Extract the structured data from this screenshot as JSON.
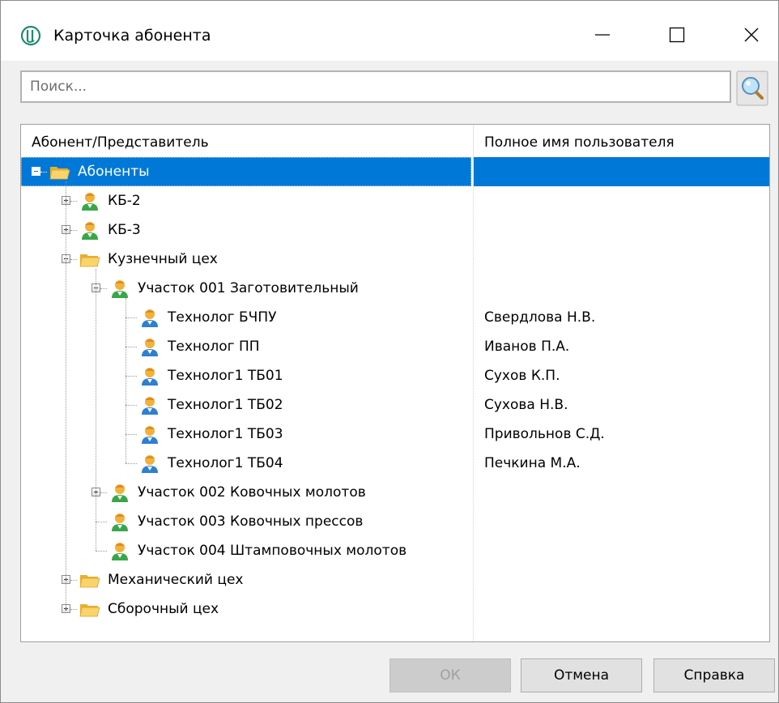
{
  "window": {
    "title": "Карточка абонента",
    "controls": {
      "minimize": "minimize-icon",
      "maximize": "maximize-icon",
      "close": "close-icon"
    }
  },
  "search": {
    "placeholder": "Поиск...",
    "value": "",
    "button_icon": "search-magnifier-icon"
  },
  "tree": {
    "columns": [
      "Абонент/Представитель",
      "Полное имя пользователя"
    ],
    "rows": [
      {
        "label": "Абоненты",
        "fullname": "",
        "level": 0,
        "icon": "folder-open-icon",
        "expander": "minus",
        "selected": true
      },
      {
        "label": "КБ-2",
        "fullname": "",
        "level": 1,
        "icon": "user-green-icon",
        "expander": "plus"
      },
      {
        "label": "КБ-3",
        "fullname": "",
        "level": 1,
        "icon": "user-green-icon",
        "expander": "plus"
      },
      {
        "label": "Кузнечный цех",
        "fullname": "",
        "level": 1,
        "icon": "folder-open-icon",
        "expander": "minus"
      },
      {
        "label": "Участок 001 Заготовительный",
        "fullname": "",
        "level": 2,
        "icon": "user-green-icon",
        "expander": "minus"
      },
      {
        "label": "Технолог БЧПУ",
        "fullname": "Свердлова Н.В.",
        "level": 3,
        "icon": "user-blue-icon"
      },
      {
        "label": "Технолог ПП",
        "fullname": "Иванов П.А.",
        "level": 3,
        "icon": "user-blue-icon"
      },
      {
        "label": "Технолог1 ТБ01",
        "fullname": "Сухов К.П.",
        "level": 3,
        "icon": "user-blue-icon"
      },
      {
        "label": "Технолог1 ТБ02",
        "fullname": "Сухова Н.В.",
        "level": 3,
        "icon": "user-blue-icon"
      },
      {
        "label": "Технолог1 ТБ03",
        "fullname": "Привольнов С.Д.",
        "level": 3,
        "icon": "user-blue-icon"
      },
      {
        "label": "Технолог1 ТБ04",
        "fullname": "Печкина М.А.",
        "level": 3,
        "icon": "user-blue-icon"
      },
      {
        "label": "Участок 002 Ковочных молотов",
        "fullname": "",
        "level": 2,
        "icon": "user-green-icon",
        "expander": "plus"
      },
      {
        "label": "Участок 003 Ковочных прессов",
        "fullname": "",
        "level": 2,
        "icon": "user-green-icon"
      },
      {
        "label": "Участок 004 Штамповочных молотов",
        "fullname": "",
        "level": 2,
        "icon": "user-green-icon"
      },
      {
        "label": "Механический цех",
        "fullname": "",
        "level": 1,
        "icon": "folder-open-icon",
        "expander": "plus"
      },
      {
        "label": "Сборочный цех",
        "fullname": "",
        "level": 1,
        "icon": "folder-open-icon",
        "expander": "plus"
      }
    ]
  },
  "buttons": {
    "ok": "ОК",
    "cancel": "Отмена",
    "help": "Справка",
    "ok_disabled": true
  },
  "colors": {
    "selection": "#0078d7",
    "folder": "#f5c542",
    "user_green": "#3aa64a",
    "user_blue": "#2f7fd1",
    "skin": "#f0a020"
  }
}
